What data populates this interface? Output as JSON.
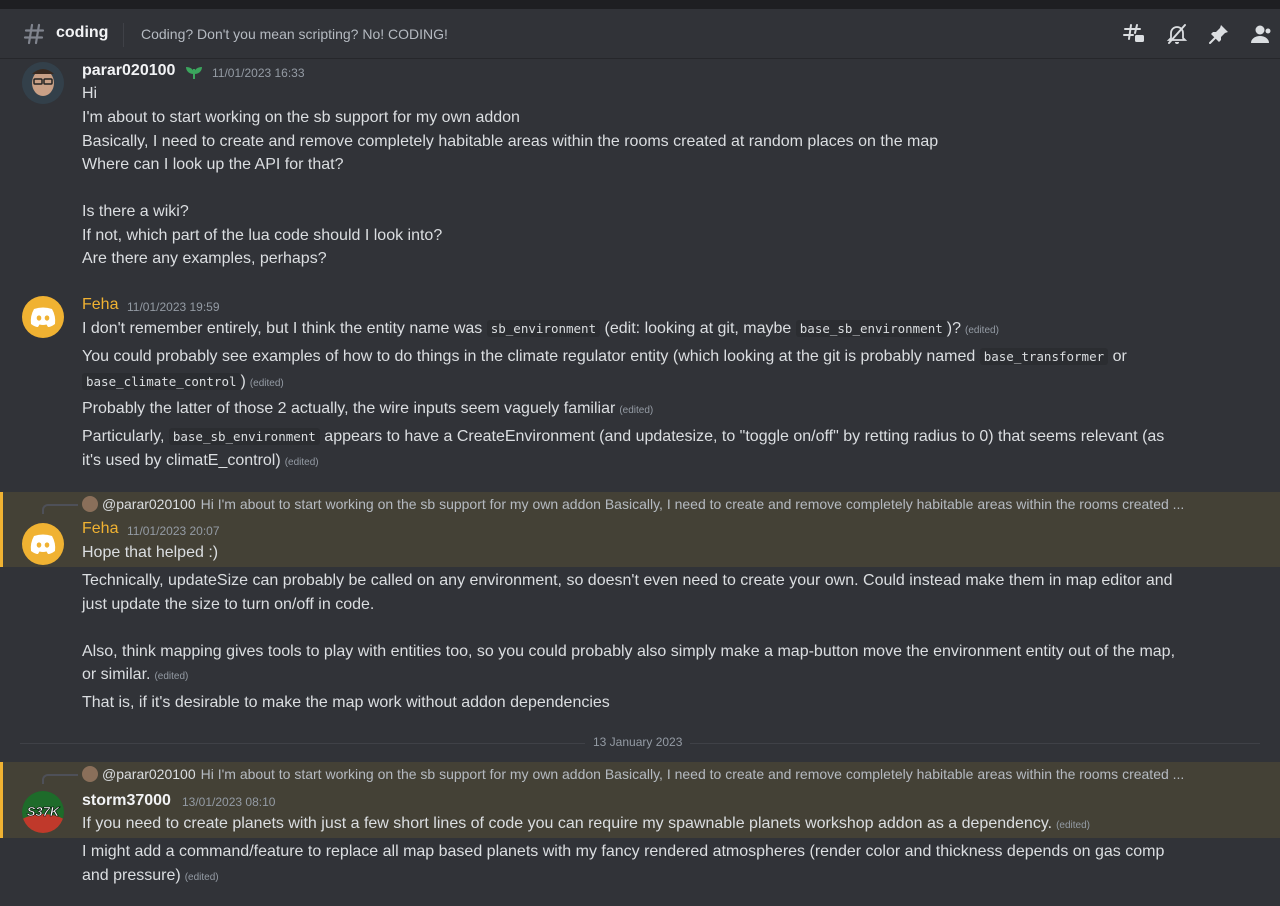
{
  "header": {
    "channel_name": "coding",
    "topic": "Coding? Don't you mean scripting? No! CODING!",
    "icons": [
      "threads-icon",
      "notification-bell-muted-icon",
      "pin-icon",
      "member-list-icon"
    ]
  },
  "messages": {
    "m1": {
      "author": "parar020100",
      "timestamp": "11/01/2023 16:33",
      "lines": [
        "Hi",
        "I'm about to start working on the sb support for my own addon",
        "Basically, I need to create and remove completely habitable areas within the rooms created at random places on the map",
        "Where can I look up the API for that?",
        "Is there a wiki?",
        "If not, which part of the lua code should I look into?",
        "Are there any examples, perhaps?"
      ]
    },
    "m2": {
      "author": "Feha",
      "timestamp": "11/01/2023 19:59",
      "l1a": "I don't remember entirely, but I think the entity name was",
      "code1": "sb_environment",
      "l1b": "(edit: looking at git, maybe",
      "code2": "base_sb_environment",
      "l1c": ")?",
      "l2a": "You could probably see examples of how to do things in the climate regulator entity (which looking at the git is probably named",
      "code3": "base_transformer",
      "l2b": "or",
      "code4": "base_climate_control",
      "l2c": ")",
      "l3": "Probably the latter of those 2 actually, the wire inputs seem vaguely familiar",
      "l4a": "Particularly,",
      "code5": "base_sb_environment",
      "l4b": "appears to have a CreateEnvironment (and updatesize, to \"toggle on/off\" by retting radius to 0) that seems relevant (as",
      "l4c": "it's used by climatE_control)"
    },
    "m3": {
      "reply_author": "@parar020100",
      "reply_text": "Hi I'm about to start working on the sb support for my own addon Basically, I need to create and remove completely habitable areas within the rooms created ...",
      "author": "Feha",
      "timestamp": "11/01/2023 20:07",
      "lines": [
        "Hope that helped :)",
        "Technically, updateSize can probably be called on any environment, so doesn't even need to create your own. Could instead make them in map editor and",
        "just update the size to turn on/off in code.",
        "Also, think mapping gives tools to play with entities too, so you could probably also simply make a map-button move the environment entity out of the map,",
        "or similar.",
        "That is, if it's desirable to make the map work without addon dependencies"
      ]
    },
    "date_separator": "13 January 2023",
    "m4": {
      "reply_author": "@parar020100",
      "reply_text": "Hi I'm about to start working on the sb support for my own addon Basically, I need to create and remove completely habitable areas within the rooms created ...",
      "author": "storm37000",
      "timestamp": "13/01/2023 08:10",
      "avatar_text": "S37K",
      "lines": [
        "If you need to create planets with just a few short lines of code you can require my spawnable planets workshop addon as a dependency.",
        "I might add a command/feature to replace all map based planets with my fancy rendered atmospheres (render color and thickness depends on gas comp",
        "and pressure)"
      ]
    },
    "edited_label": "(edited)"
  },
  "colors": {
    "background": "#313338",
    "highlight": "#444136",
    "highlight_bar": "#f0b232",
    "feha_name": "#f0b232",
    "code_bg": "#2b2d31"
  }
}
